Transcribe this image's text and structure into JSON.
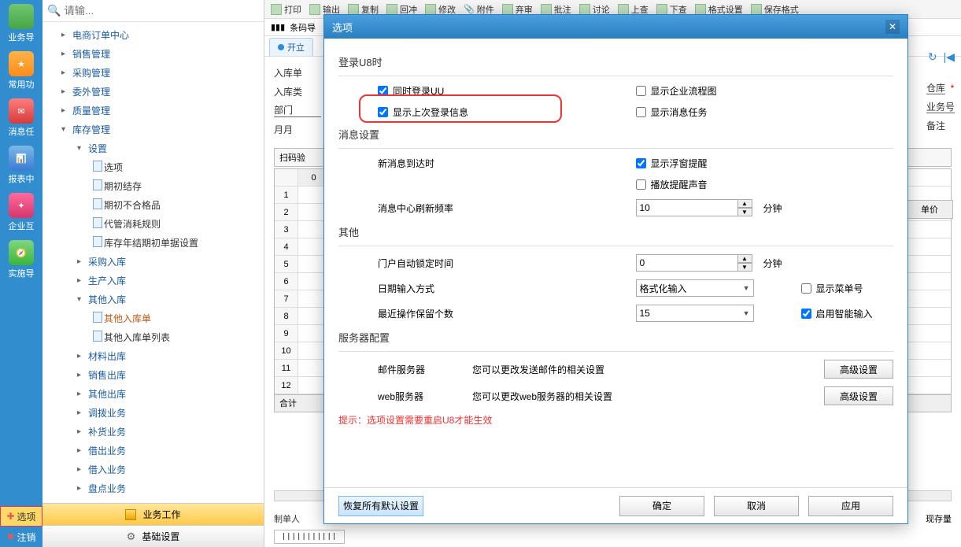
{
  "left_sidebar": {
    "items": [
      {
        "label": "业务导"
      },
      {
        "label": "常用功"
      },
      {
        "label": "消息任"
      },
      {
        "label": "报表中"
      },
      {
        "label": "企业互"
      },
      {
        "label": "实施导"
      }
    ],
    "bottom_options": "选项",
    "bottom_logout": "注销"
  },
  "search": {
    "placeholder": "请输..."
  },
  "tree": {
    "items": [
      {
        "label": "电商订单中心",
        "lv": 1,
        "exp": false
      },
      {
        "label": "销售管理",
        "lv": 1,
        "exp": false
      },
      {
        "label": "采购管理",
        "lv": 1,
        "exp": false
      },
      {
        "label": "委外管理",
        "lv": 1,
        "exp": false
      },
      {
        "label": "质量管理",
        "lv": 1,
        "exp": false
      },
      {
        "label": "库存管理",
        "lv": 1,
        "exp": true
      },
      {
        "label": "设置",
        "lv": 2,
        "exp": true
      },
      {
        "label": "选项",
        "lv": 3,
        "leaf": true
      },
      {
        "label": "期初结存",
        "lv": 3,
        "leaf": true
      },
      {
        "label": "期初不合格品",
        "lv": 3,
        "leaf": true
      },
      {
        "label": "代管消耗规则",
        "lv": 3,
        "leaf": true
      },
      {
        "label": "库存年结期初单据设置",
        "lv": 3,
        "leaf": true
      },
      {
        "label": "采购入库",
        "lv": 2,
        "exp": false
      },
      {
        "label": "生产入库",
        "lv": 2,
        "exp": false
      },
      {
        "label": "其他入库",
        "lv": 2,
        "exp": true
      },
      {
        "label": "其他入库单",
        "lv": 3,
        "leaf": true,
        "selected": true
      },
      {
        "label": "其他入库单列表",
        "lv": 3,
        "leaf": true
      },
      {
        "label": "材料出库",
        "lv": 2,
        "exp": false
      },
      {
        "label": "销售出库",
        "lv": 2,
        "exp": false
      },
      {
        "label": "其他出库",
        "lv": 2,
        "exp": false
      },
      {
        "label": "调拨业务",
        "lv": 2,
        "exp": false
      },
      {
        "label": "补货业务",
        "lv": 2,
        "exp": false
      },
      {
        "label": "借出业务",
        "lv": 2,
        "exp": false
      },
      {
        "label": "借入业务",
        "lv": 2,
        "exp": false
      },
      {
        "label": "盘点业务",
        "lv": 2,
        "exp": false
      }
    ]
  },
  "nav_footer": {
    "business": "业务工作",
    "basic": "基础设置"
  },
  "toolbar": {
    "print": "打印",
    "output": "输出",
    "modify": "修改",
    "attach": "附件",
    "abandon": "弃审",
    "review": "讨论",
    "up": "上查",
    "down": "下查",
    "save_fmt": "保存格式",
    "format": "格式设置",
    "batch": "批注",
    "back": "回冲",
    "copy": "复制"
  },
  "barcode_label": "条码导",
  "tab_open": "开立",
  "form": {
    "in_code": "入库单",
    "in_type": "入库类",
    "dept": "部门",
    "month": "月月",
    "warehouse": "仓库",
    "biz_no": "业务号",
    "remark": "备注",
    "required": "*"
  },
  "scan_label": "扫码验",
  "grid": {
    "rows": [
      "1",
      "2",
      "3",
      "4",
      "5",
      "6",
      "7",
      "8",
      "9",
      "10",
      "11",
      "12"
    ],
    "header_cell": "0",
    "total": "合计",
    "price": "单价"
  },
  "footer_main": {
    "maker": "制单人",
    "stock": "现存量"
  },
  "dialog": {
    "title": "选项",
    "sec_login": "登录U8时",
    "cb_login_uu": "同时登录UU",
    "cb_show_flow": "显示企业流程图",
    "cb_show_last": "显示上次登录信息",
    "cb_show_msg": "显示消息任务",
    "sec_msg": "消息设置",
    "lbl_new_msg": "新消息到达时",
    "cb_popup": "显示浮窗提醒",
    "cb_sound": "播放提醒声音",
    "lbl_refresh": "消息中心刷新频率",
    "refresh_val": "10",
    "unit_min": "分钟",
    "sec_other": "其他",
    "lbl_lock": "门户自动锁定时间",
    "lock_val": "0",
    "lbl_date": "日期输入方式",
    "date_val": "格式化输入",
    "cb_menu_no": "显示菜单号",
    "lbl_recent": "最近操作保留个数",
    "recent_val": "15",
    "cb_smart": "启用智能输入",
    "sec_server": "服务器配置",
    "lbl_mail": "邮件服务器",
    "mail_desc": "您可以更改发送邮件的相关设置",
    "lbl_web": "web服务器",
    "web_desc": "您可以更改web服务器的相关设置",
    "adv_btn": "高级设置",
    "hint": "提示：选项设置需要重启U8才能生效",
    "restore": "恢复所有默认设置",
    "ok": "确定",
    "cancel": "取消",
    "apply": "应用"
  }
}
